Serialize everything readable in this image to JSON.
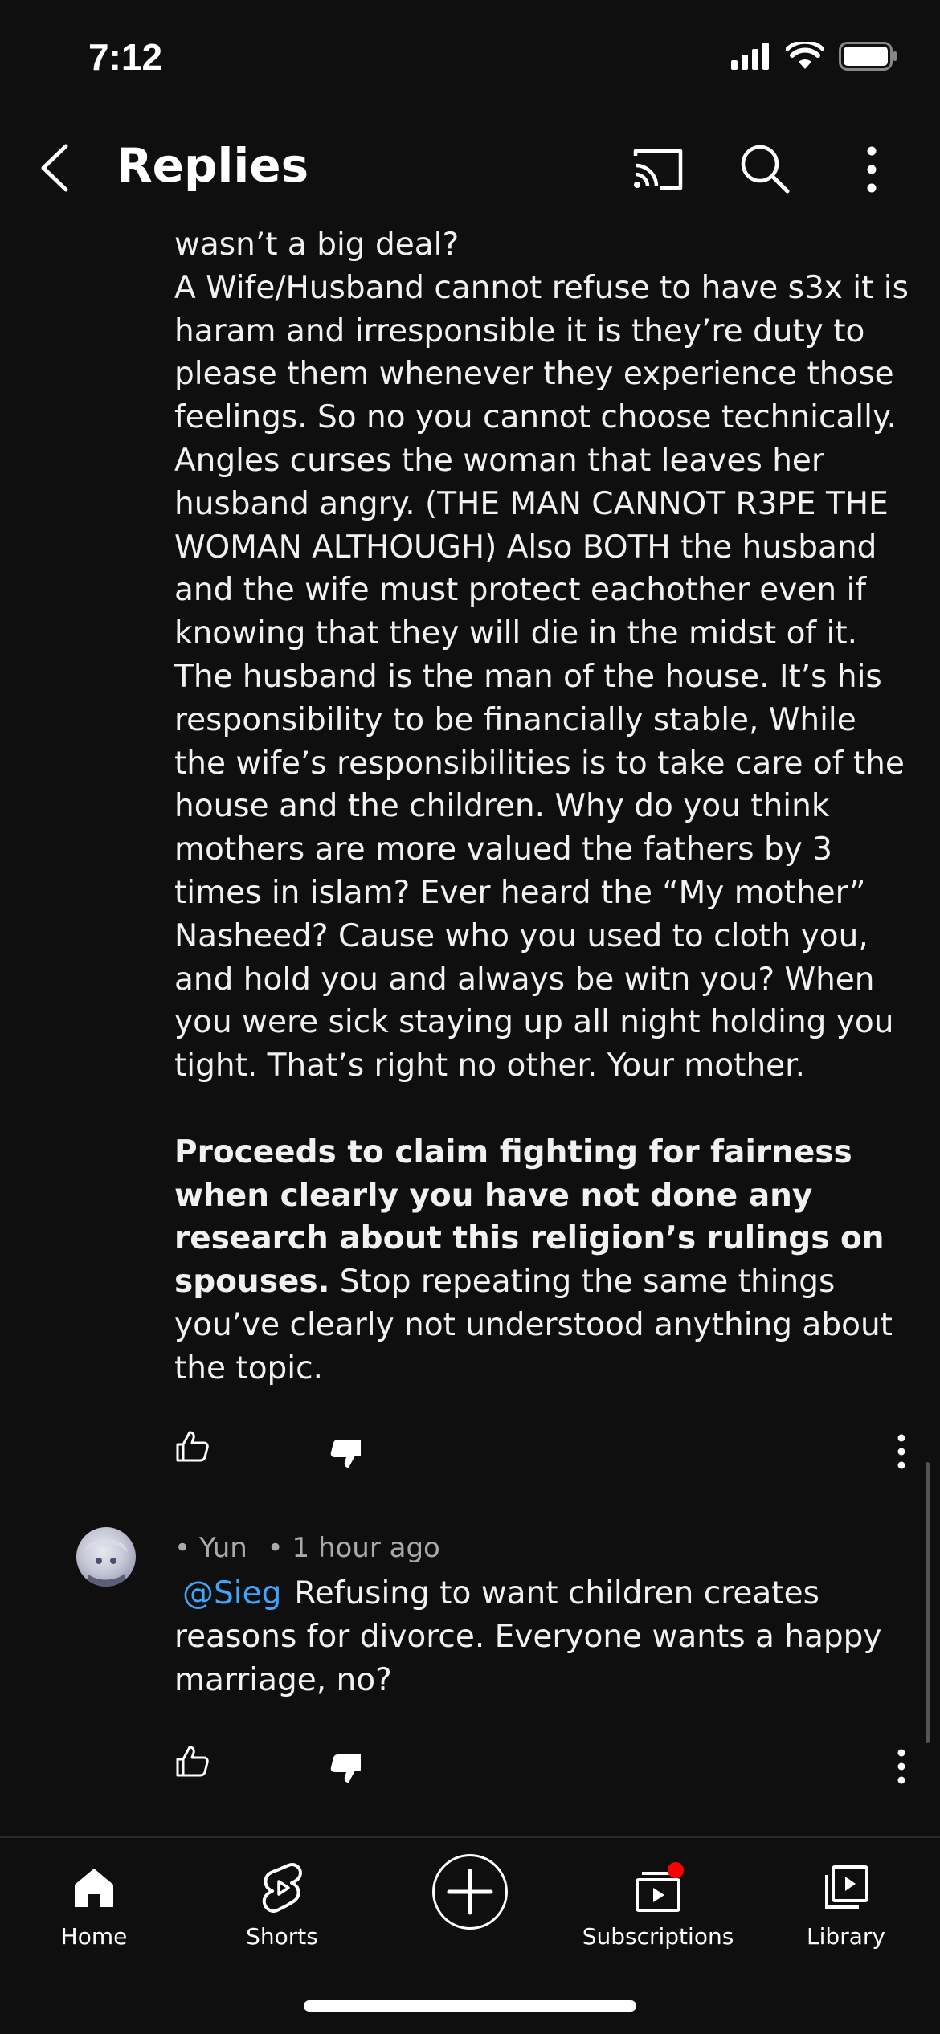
{
  "status_bar": {
    "time": "7:12"
  },
  "header": {
    "title": "Replies"
  },
  "comment": {
    "paragraphs": [
      "wasn’t a big deal?",
      "A Wife/Husband cannot refuse to have s3x it is haram and irresponsible it is they’re duty to please them whenever they experience those feelings. So no you cannot choose technically. Angles curses the woman that leaves her husband angry. (THE MAN CANNOT R3PE THE WOMAN ALTHOUGH) Also BOTH the husband and the wife must protect eachother even if knowing that they will die in the midst of it.",
      "The husband is the man of the house. It’s his responsibility to be financially stable, While the wife’s responsibilities is to take care of the house and the children. Why do you think mothers are more valued the fathers by 3 times in islam? Ever heard the “My mother” Nasheed? Cause who you used to cloth you, and hold you and always be witn you? When you were sick staying up all night holding you tight. That’s right no other. Your mother."
    ],
    "bold_text": "Proceeds to claim fighting for fairness when clearly you have not done any research about this religion’s rulings on spouses.",
    "closing_text": " Stop repeating the same things you’ve clearly not understood anything about the topic."
  },
  "reply": {
    "author": "• Yun",
    "time": "• 1 hour ago",
    "mention": "@Sieg",
    "text": "Refusing to want children creates reasons for divorce. Everyone wants a happy marriage, no?"
  },
  "bottom_nav": {
    "items": [
      {
        "label": "Home",
        "icon": "home-icon"
      },
      {
        "label": "Shorts",
        "icon": "shorts-icon"
      },
      {
        "label": "",
        "icon": "create-icon"
      },
      {
        "label": "Subscriptions",
        "icon": "subscriptions-icon"
      },
      {
        "label": "Library",
        "icon": "library-icon"
      }
    ]
  },
  "colors": {
    "background": "#0f0f0f",
    "text": "#f1f1f1",
    "mention": "#3ea6ff",
    "notification_dot": "#ff0000",
    "meta": "#aaaaaa"
  }
}
